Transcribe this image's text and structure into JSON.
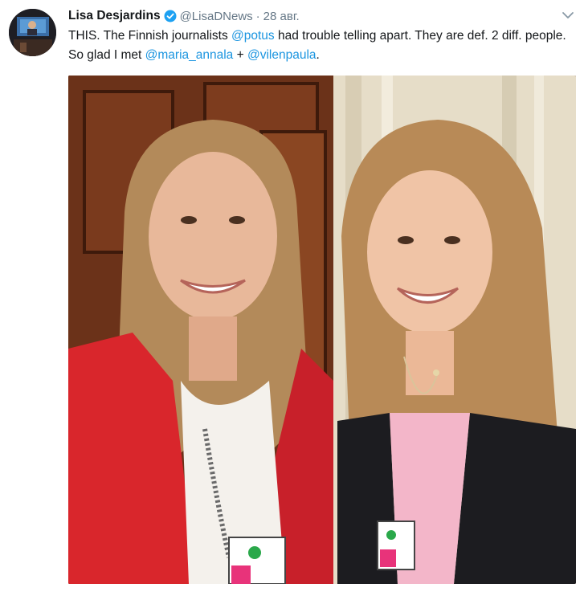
{
  "tweet": {
    "author_name": "Lisa Desjardins",
    "author_handle": "@LisaDNews",
    "separator": "·",
    "date": "28 авг.",
    "text_segments": [
      {
        "text": "THIS. The Finnish journalists ",
        "type": "text"
      },
      {
        "text": "@potus",
        "type": "mention"
      },
      {
        "text": " had trouble telling apart. They are def. 2 diff. people. So glad I met ",
        "type": "text"
      },
      {
        "text": "@maria_annala",
        "type": "mention"
      },
      {
        "text": " + ",
        "type": "text"
      },
      {
        "text": "@vilenpaula",
        "type": "mention"
      },
      {
        "text": ".",
        "type": "text"
      }
    ]
  },
  "icons": {
    "verified": "verified-badge-icon",
    "menu": "chevron-down-icon"
  },
  "colors": {
    "link": "#1b95e0",
    "verified": "#1da1f2",
    "muted": "#657786",
    "text": "#14171a"
  }
}
